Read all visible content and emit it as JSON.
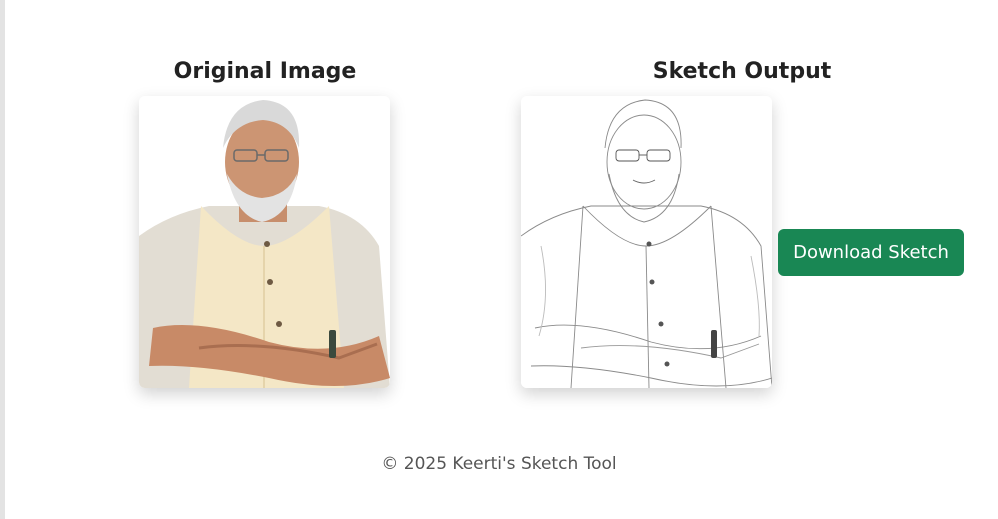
{
  "original": {
    "title": "Original Image",
    "image_alt": "portrait-photo"
  },
  "sketch": {
    "title": "Sketch Output",
    "image_alt": "pencil-sketch-portrait"
  },
  "actions": {
    "download_label": "Download Sketch",
    "button_color": "#198754"
  },
  "footer": {
    "text": "© 2025 Keerti's Sketch Tool"
  }
}
